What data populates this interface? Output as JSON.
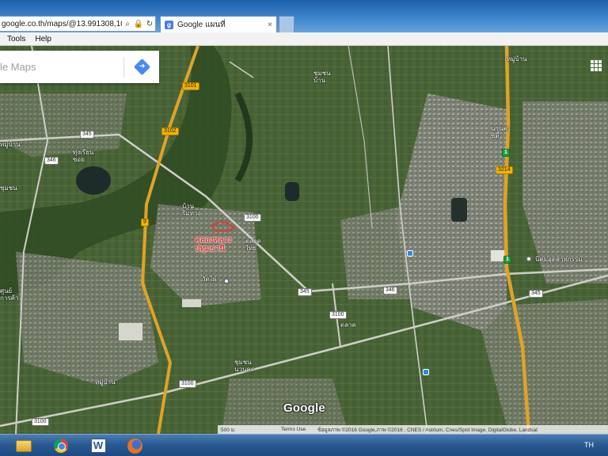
{
  "browser": {
    "url": "google.co.th/maps/@13.991308,100.",
    "active_tab_title": "Google แผนที่",
    "tab_close": "×"
  },
  "menu": {
    "items": [
      "Tools",
      "Help"
    ]
  },
  "maps": {
    "search_placeholder": "le Maps",
    "logo": "Google",
    "scale": "500 ม.",
    "terms": "Terms Use",
    "attribution": "ข้อมูลภาพ ©2016 Google,ภาพ ©2016 , CNES / Astrium, Cnes/Spot Image, DigitalGlobe, Landsat",
    "road_shields": [
      "3101",
      "3102",
      "345",
      "346",
      "3100",
      "9",
      "3214",
      "1",
      "345",
      "346",
      "3100",
      "345",
      "3100",
      "3100"
    ],
    "highway_labels": [
      "1"
    ],
    "colors": {
      "water": "#1e2b2b",
      "green": "#3b5a2c",
      "urban": "#8a8c80",
      "highway": "#e0a326",
      "road": "#d7d7d0",
      "marker": "#e03a3a"
    }
  },
  "taskbar": {
    "language": "TH"
  }
}
